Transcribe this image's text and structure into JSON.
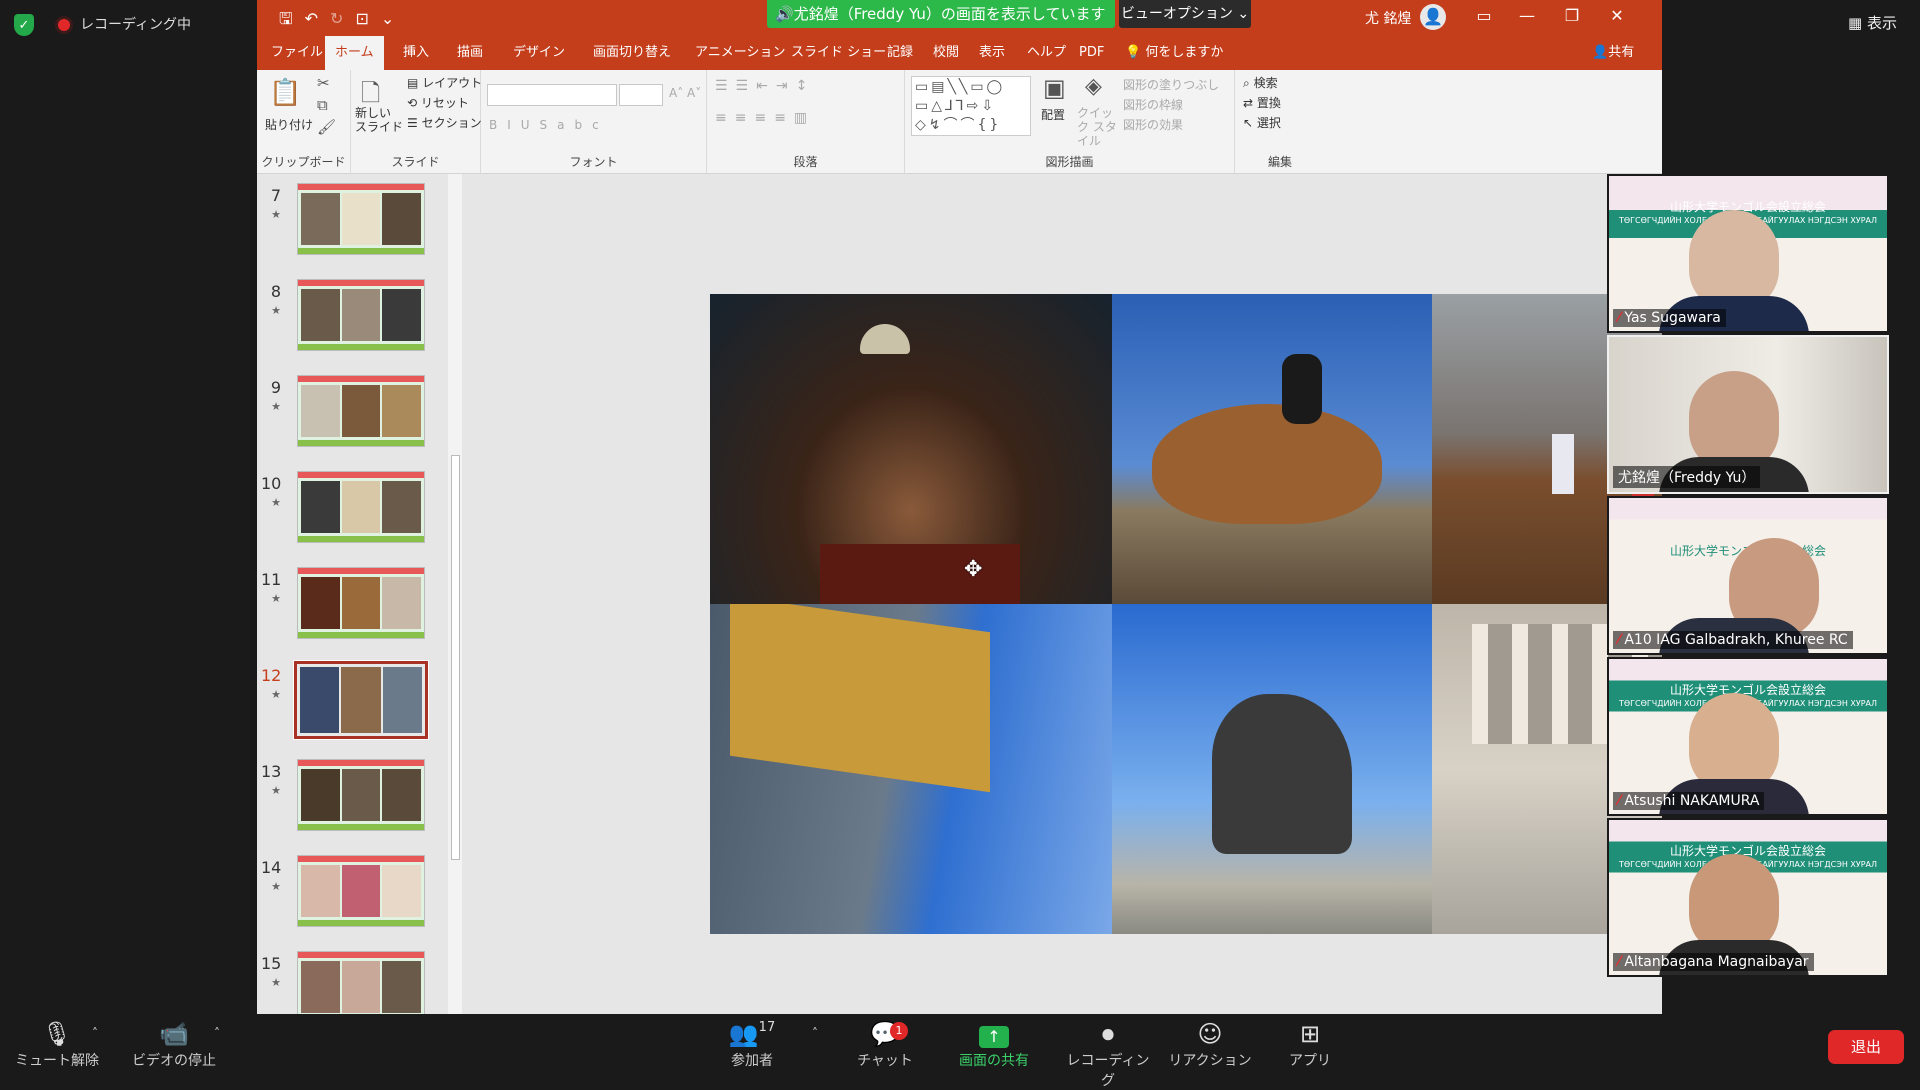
{
  "zoom": {
    "recording_label": "レコーディング中",
    "view_label": "表示",
    "share_banner": "尤銘煌（Freddy Yu）の画面を表示しています",
    "view_options": "ビューオプション",
    "end_label": "退出",
    "toolbar": {
      "unmute": "ミュート解除",
      "video": "ビデオの停止",
      "participants": "参加者",
      "participants_count": "17",
      "chat": "チャット",
      "chat_badge": "1",
      "share": "画面の共有",
      "record": "レコーディング",
      "reactions": "リアクション",
      "apps": "アプリ"
    },
    "participants": [
      {
        "name": "Yas Sugawara"
      },
      {
        "name": "尤銘煌（Freddy Yu）"
      },
      {
        "name": "A10 IAG Galbadrakh, Khuree RC"
      },
      {
        "name": "Atsushi NAKAMURA"
      },
      {
        "name": "Altanbagana Magnaibayar"
      }
    ],
    "tile_banner_1": "山形大学モンゴル会設立総会",
    "tile_banner_2": "ТӨГСӨГЧДИЙН ХОЛБОО ҮҮСГЭН БАЙГУУЛАХ НЭГДСЭН ХУРАЛ"
  },
  "ppt": {
    "user_name": "尤 銘煌",
    "menu_tabs": [
      "ファイル",
      "ホーム",
      "挿入",
      "描画",
      "デザイン",
      "画面切り替え",
      "アニメーション",
      "スライド ショー",
      "記録",
      "校閲",
      "表示",
      "ヘルプ",
      "PDF",
      "何をしますか"
    ],
    "share_tab": "共有",
    "ribbon": {
      "paste": "貼り付け",
      "new_slide": "新しい スライド",
      "layout": "レイアウト",
      "reset": "リセット",
      "section": "セクション",
      "g_clipboard": "クリップボード",
      "g_slide": "スライド",
      "g_font": "フォント",
      "g_paragraph": "段落",
      "g_drawing": "図形描画",
      "g_edit": "編集",
      "arrange": "配置",
      "quick_style": "クイック スタイル",
      "shape_fill": "図形の塗りつぶし",
      "shape_outline": "図形の枠線",
      "shape_effect": "図形の効果",
      "find": "検索",
      "replace": "置換",
      "select": "選択"
    },
    "slides": [
      {
        "num": "7"
      },
      {
        "num": "8"
      },
      {
        "num": "9"
      },
      {
        "num": "10"
      },
      {
        "num": "11"
      },
      {
        "num": "12",
        "selected": true
      },
      {
        "num": "13"
      },
      {
        "num": "14"
      },
      {
        "num": "15"
      }
    ]
  }
}
